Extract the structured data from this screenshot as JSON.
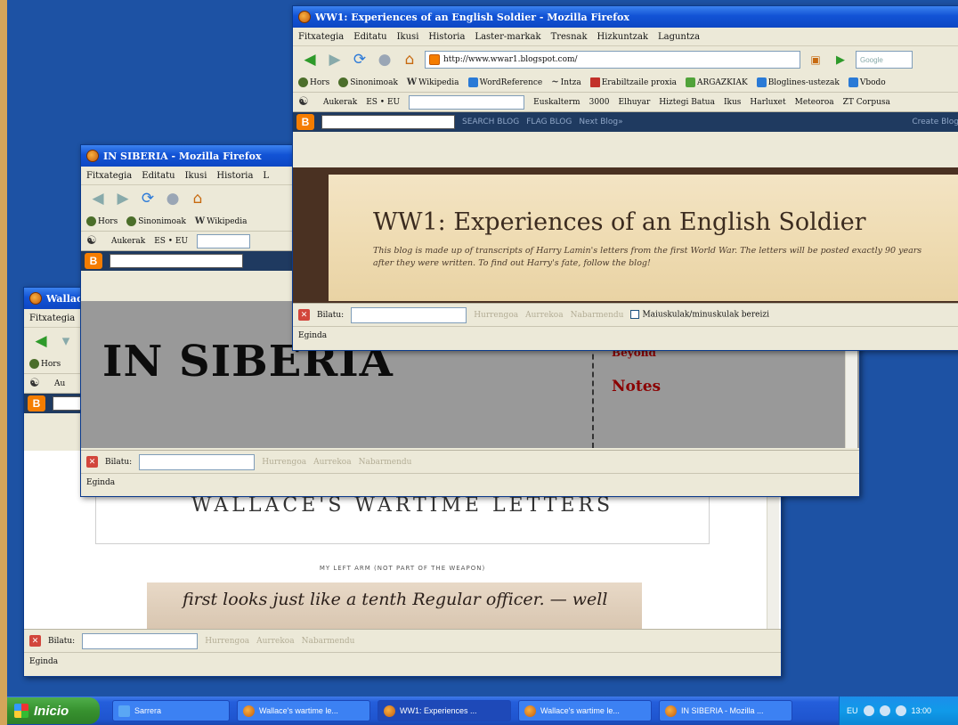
{
  "windows": {
    "front": {
      "title": "WW1: Experiences of an English Soldier - Mozilla Firefox",
      "menu": [
        "Fitxategia",
        "Editatu",
        "Ikusi",
        "Historia",
        "Laster-markak",
        "Tresnak",
        "Hizkuntzak",
        "Laguntza"
      ],
      "url": "http://www.wwar1.blogspot.com/",
      "search_placeholder": "Google",
      "bookmarks": [
        "Hors",
        "Sinonimoak",
        "Wikipedia",
        "WordReference",
        "Intza",
        "Erabiltzaile proxia",
        "ARGAZKIAK",
        "Bloglines-ustezak",
        "Vbodo"
      ],
      "extbar": [
        "Aukerak",
        "ES • EU",
        "Euskalterm",
        "3000",
        "Elhuyar",
        "Hiztegi Batua",
        "Ikus",
        "Harluxet",
        "Meteoroa",
        "ZT Corpusa"
      ],
      "blog_nav": [
        "SEARCH BLOG",
        "FLAG BLOG",
        "Next Blog»"
      ],
      "create_blog": "Create Blog",
      "blog_title": "WW1: Experiences of an English Soldier",
      "blog_desc": "This blog is made up of transcripts of Harry Lamin's letters from the first World War. The letters will be posted exactly 90 years after they were written. To find out Harry's fate, follow the blog!",
      "find_label": "Bilatu:",
      "find_next": "Hurrengoa",
      "find_prev": "Aurrekoa",
      "highlight": "Nabarmendu",
      "match_case": "Maiuskulak/minuskulak bereizi",
      "status": "Eginda"
    },
    "middle": {
      "title": "IN SIBERIA - Mozilla Firefox",
      "menu": [
        "Fitxategia",
        "Editatu",
        "Ikusi",
        "Historia",
        "L"
      ],
      "bookmarks": [
        "Hors",
        "Sinonimoak",
        "Wikipedia"
      ],
      "extbar": [
        "Aukerak",
        "ES • EU"
      ],
      "heading": "IN SIBERIA",
      "sidebar_link": "The Diary of An American Infantryman in WWI Siberia and Beyond",
      "sidebar_notes": "Notes",
      "find_label": "Bilatu:",
      "find_next": "Hurrengoa",
      "find_prev": "Aurrekoa",
      "highlight": "Nabarmendu",
      "status": "Eginda"
    },
    "back": {
      "title": "Wallace's wartime le...",
      "menu": [
        "Fitxategia"
      ],
      "bookmarks": [
        "Hors"
      ],
      "extbar": [
        "Au"
      ],
      "heading": "WALLACE'S WARTIME LETTERS",
      "caption": "MY LEFT ARM (NOT PART OF THE WEAPON)",
      "letter_text": "first looks just like a tenth Regular officer. — well",
      "find_label": "Bilatu:",
      "find_next": "Hurrengoa",
      "find_prev": "Aurrekoa",
      "highlight": "Nabarmendu",
      "status": "Eginda"
    }
  },
  "taskbar": {
    "start": "Inicio",
    "tasks": [
      "Sarrera",
      "Wallace's wartime le...",
      "WW1: Experiences ...",
      "Wallace's wartime le...",
      "IN SIBERIA - Mozilla ..."
    ],
    "tray_lang": "EU",
    "clock": "13:00"
  },
  "colors": {
    "desktop": "#1d52a4",
    "titlebar": "#1253d5",
    "blog_link_red": "#8b0000",
    "parchment": "#efdcb3"
  }
}
